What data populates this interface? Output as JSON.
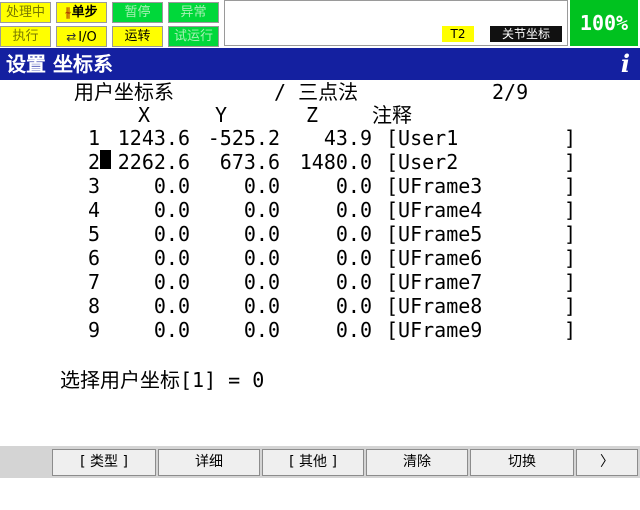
{
  "status": {
    "processing": "处理中",
    "step": "单步",
    "hold": "暂停",
    "fault": "异常",
    "execute": "执行",
    "io": "I/O",
    "running": "运转",
    "test_run": "试运行",
    "mode": "T2",
    "coord_system": "关节坐标",
    "override": "100%"
  },
  "header": {
    "title": "设置 坐标系",
    "info_icon": "i"
  },
  "screen": {
    "subtitle": "用户坐标系",
    "method": "/ 三点法",
    "page": "2/9",
    "columns": {
      "x": "X",
      "y": "Y",
      "z": "Z",
      "comment": "注释"
    }
  },
  "frames": [
    {
      "no": "1",
      "x": "1243.6",
      "y": "-525.2",
      "z": "43.9",
      "comment": "[User1"
    },
    {
      "no": "2",
      "x": "2262.6",
      "y": "673.6",
      "z": "1480.0",
      "comment": "[User2"
    },
    {
      "no": "3",
      "x": "0.0",
      "y": "0.0",
      "z": "0.0",
      "comment": "[UFrame3"
    },
    {
      "no": "4",
      "x": "0.0",
      "y": "0.0",
      "z": "0.0",
      "comment": "[UFrame4"
    },
    {
      "no": "5",
      "x": "0.0",
      "y": "0.0",
      "z": "0.0",
      "comment": "[UFrame5"
    },
    {
      "no": "6",
      "x": "0.0",
      "y": "0.0",
      "z": "0.0",
      "comment": "[UFrame6"
    },
    {
      "no": "7",
      "x": "0.0",
      "y": "0.0",
      "z": "0.0",
      "comment": "[UFrame7"
    },
    {
      "no": "8",
      "x": "0.0",
      "y": "0.0",
      "z": "0.0",
      "comment": "[UFrame8"
    },
    {
      "no": "9",
      "x": "0.0",
      "y": "0.0",
      "z": "0.0",
      "comment": "[UFrame9"
    }
  ],
  "row_end": "]",
  "selected_frame_text": "选择用户坐标[1] = 0",
  "function_keys": {
    "f1": "[ 类型 ]",
    "f2": "详细",
    "f3": "[ 其他 ]",
    "f4": "清除",
    "f5": "切换",
    "next": "〉"
  },
  "colors": {
    "title_bar": "#1420a0",
    "status_active": "#ffff00",
    "status_inactive": "#00d83a",
    "override_bg": "#00c21f"
  },
  "icons": [
    "step-icon",
    "io-icon",
    "info-icon",
    "next-page-icon"
  ]
}
